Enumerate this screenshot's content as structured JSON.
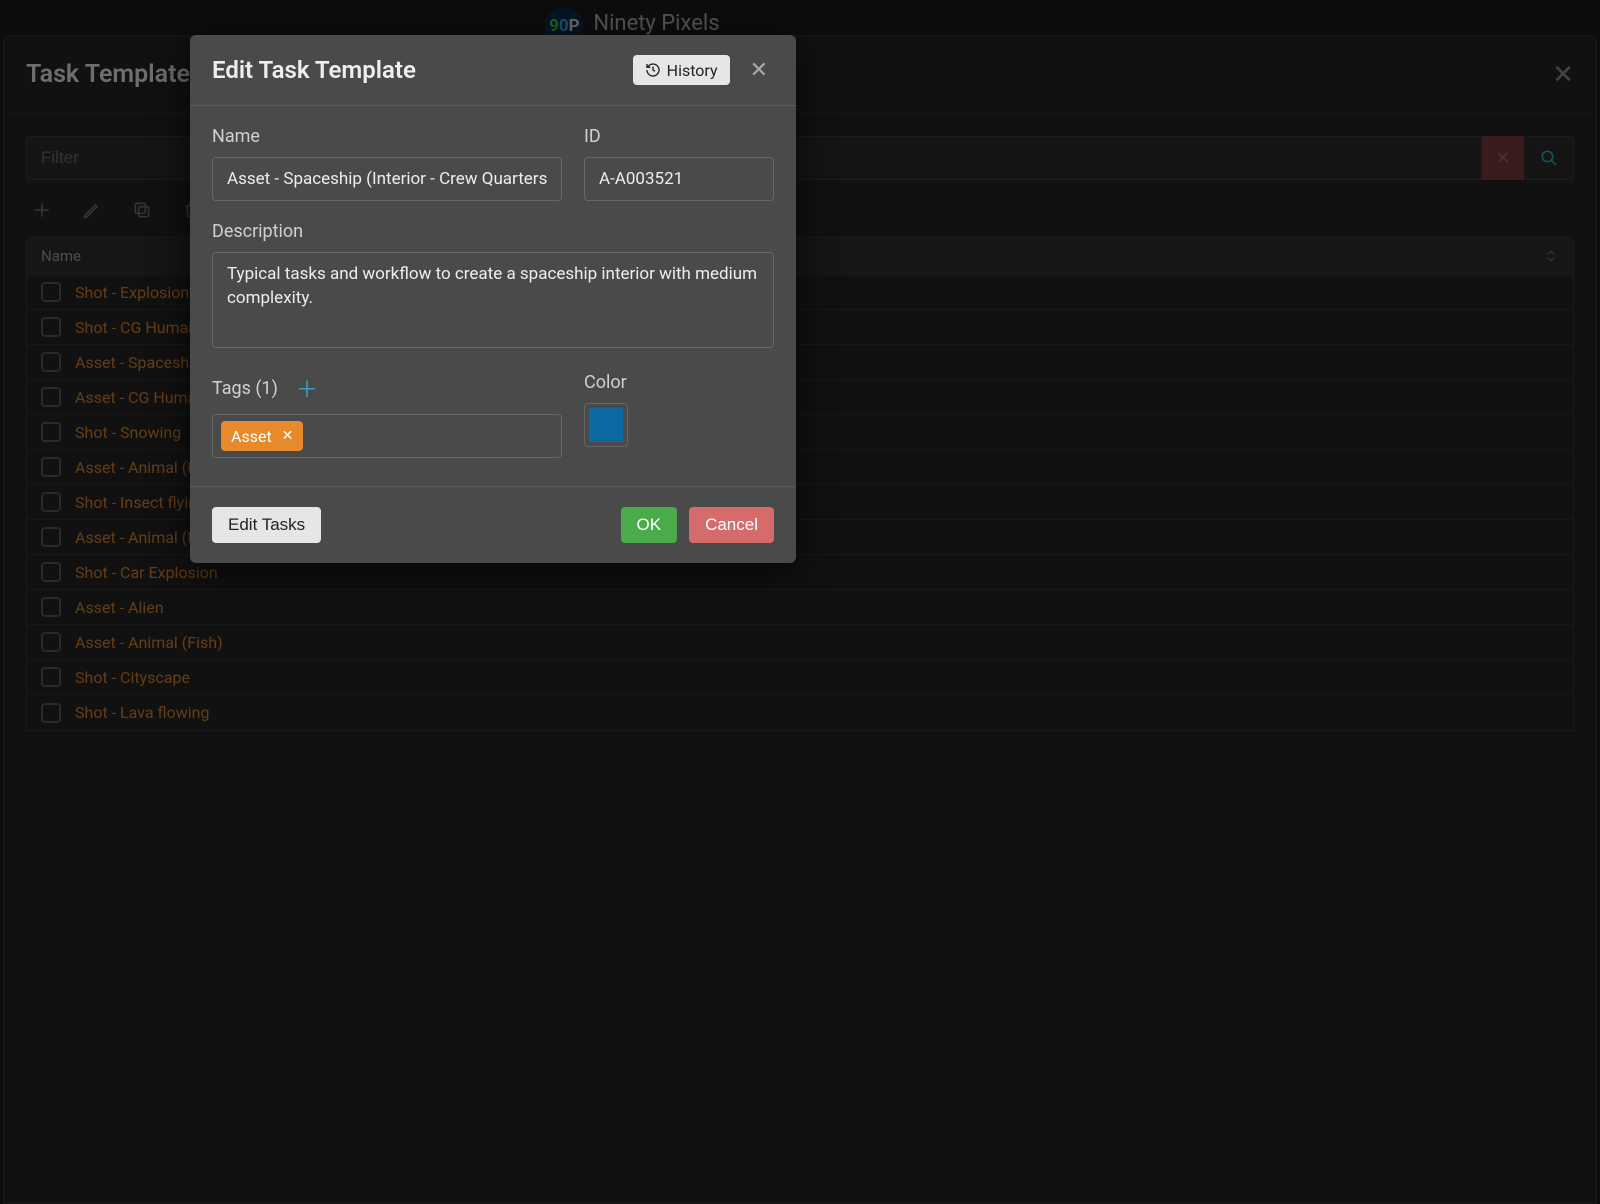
{
  "brand": {
    "name": "Ninety Pixels"
  },
  "panel": {
    "title": "Task Templates",
    "filter_placeholder": "Filter",
    "columns": {
      "name": "Name"
    },
    "rows": [
      "Shot - Explosion (",
      "Shot - CG Human",
      "Asset - Spaceship",
      "Asset - CG Human",
      "Shot - Snowing",
      "Asset - Animal (B",
      "Shot - Insect flying",
      "Asset - Animal (I",
      "Shot - Car Explosion",
      "Asset - Alien",
      "Asset - Animal (Fish)",
      "Shot - Cityscape",
      "Shot - Lava flowing"
    ]
  },
  "modal": {
    "title": "Edit Task Template",
    "history_label": "History",
    "labels": {
      "name": "Name",
      "id": "ID",
      "description": "Description",
      "tags": "Tags (1)",
      "color": "Color"
    },
    "fields": {
      "name": "Asset - Spaceship (Interior - Crew Quarters, Cockpit)",
      "id": "A-A003521",
      "description": "Typical tasks and workflow to create a spaceship interior with medium complexity."
    },
    "tags": [
      "Asset"
    ],
    "color": "#0a6aa1",
    "buttons": {
      "edit_tasks": "Edit Tasks",
      "ok": "OK",
      "cancel": "Cancel"
    }
  }
}
